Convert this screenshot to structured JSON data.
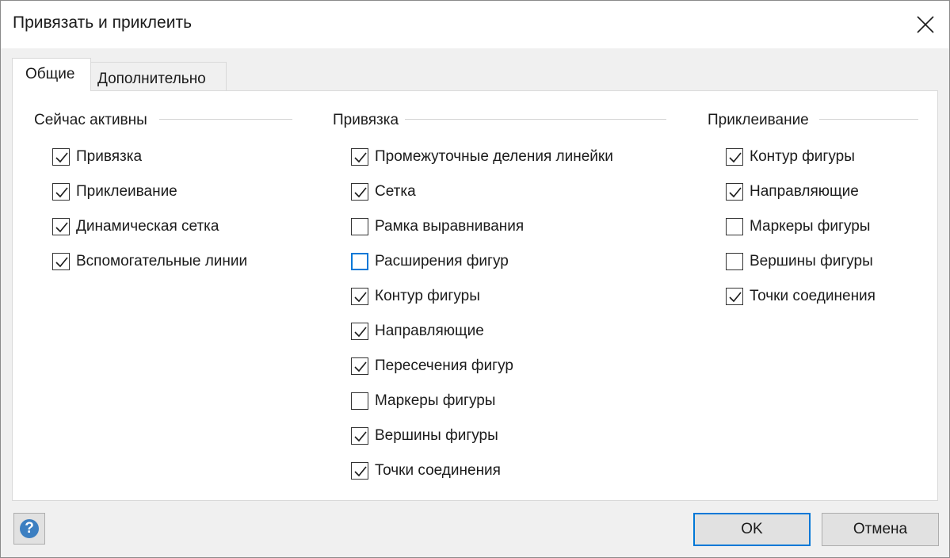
{
  "window": {
    "title": "Привязать и приклеить"
  },
  "tabs": [
    {
      "label": "Общие",
      "active": true
    },
    {
      "label": "Дополнительно",
      "active": false
    }
  ],
  "groups": {
    "active": {
      "title": "Сейчас активны",
      "items": [
        {
          "label": "Привязка",
          "checked": true
        },
        {
          "label": "Приклеивание",
          "checked": true
        },
        {
          "label": "Динамическая сетка",
          "checked": true
        },
        {
          "label": "Вспомогательные линии",
          "checked": true
        }
      ]
    },
    "snap": {
      "title": "Привязка",
      "items": [
        {
          "label": "Промежуточные деления линейки",
          "checked": true
        },
        {
          "label": "Сетка",
          "checked": true
        },
        {
          "label": "Рамка выравнивания",
          "checked": false
        },
        {
          "label": "Расширения фигур",
          "checked": false,
          "focused": true
        },
        {
          "label": "Контур фигуры",
          "checked": true
        },
        {
          "label": "Направляющие",
          "checked": true
        },
        {
          "label": "Пересечения фигур",
          "checked": true
        },
        {
          "label": "Маркеры фигуры",
          "checked": false
        },
        {
          "label": "Вершины фигуры",
          "checked": true
        },
        {
          "label": "Точки соединения",
          "checked": true
        }
      ]
    },
    "glue": {
      "title": "Приклеивание",
      "items": [
        {
          "label": "Контур фигуры",
          "checked": true
        },
        {
          "label": "Направляющие",
          "checked": true
        },
        {
          "label": "Маркеры фигуры",
          "checked": false
        },
        {
          "label": "Вершины фигуры",
          "checked": false
        },
        {
          "label": "Точки соединения",
          "checked": true
        }
      ]
    }
  },
  "footer": {
    "help_glyph": "?",
    "ok_label": "OK",
    "cancel_label": "Отмена"
  },
  "colors": {
    "accent": "#0078d7",
    "help_icon": "#3c7fc1"
  }
}
